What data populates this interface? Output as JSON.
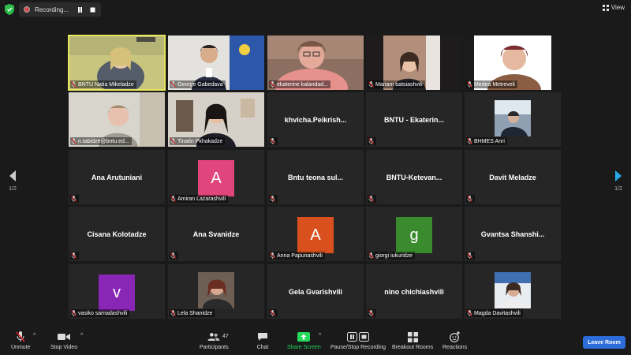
{
  "top": {
    "recording_label": "Recording...",
    "view_label": "View"
  },
  "pager": {
    "left": "1/2",
    "right": "1/2"
  },
  "tiles": [
    {
      "name": "BNTU Natia Mikeladze",
      "type": "video",
      "active": true
    },
    {
      "name": "George Gabedava",
      "type": "video"
    },
    {
      "name": "ekaterine kalandad...",
      "type": "video"
    },
    {
      "name": "Mariam batsiashvili",
      "type": "video"
    },
    {
      "name": "Medea Metreveli",
      "type": "video"
    },
    {
      "name": "n.tabidze@bntu.ed...",
      "type": "video"
    },
    {
      "name": "Tinatin Pkhakadze",
      "type": "video"
    },
    {
      "name": "khvicha.Peikrish...",
      "type": "name"
    },
    {
      "name": "BNTU - Ekaterin...",
      "type": "name"
    },
    {
      "name": "BHMES Anri",
      "type": "photo"
    },
    {
      "name": "Ana Arutuniani",
      "type": "name"
    },
    {
      "name": "Amiran Lazarashvili",
      "type": "avatar",
      "letter": "A",
      "color": "#e0457b"
    },
    {
      "name": "Bntu    teona sul...",
      "type": "name"
    },
    {
      "name": "BNTU-Ketevan...",
      "type": "name"
    },
    {
      "name": "Davit Meladze",
      "type": "name"
    },
    {
      "name": "Cisana Kolotadze",
      "type": "name"
    },
    {
      "name": "Ana Svanidze",
      "type": "name"
    },
    {
      "name": "Anna Papunashvili",
      "type": "avatar",
      "letter": "A",
      "color": "#d9501e"
    },
    {
      "name": "giorgi iukuridze",
      "type": "avatar",
      "letter": "g",
      "color": "#3a8a2e"
    },
    {
      "name": "Gvantsa  Shanshi...",
      "type": "name"
    },
    {
      "name": "vasiko samadashvili",
      "type": "avatar",
      "letter": "v",
      "color": "#8a26b5"
    },
    {
      "name": "Lela Shanidze",
      "type": "photo"
    },
    {
      "name": "Gela Gvarishvili",
      "type": "name"
    },
    {
      "name": "nino chichiashvili",
      "type": "name"
    },
    {
      "name": "Magda Davitashvili",
      "type": "photo"
    }
  ],
  "toolbar": {
    "unmute": "Unmute",
    "stop_video": "Stop Video",
    "participants": "Participants",
    "participants_count": "47",
    "chat": "Chat",
    "share_screen": "Share Screen",
    "pause_recording": "Pause/Stop Recording",
    "breakout_rooms": "Breakout Rooms",
    "reactions": "Reactions",
    "leave": "Leave Room"
  },
  "colors": {
    "background": "#1a1a1a",
    "tile": "#262626",
    "active_border": "#e7e75d",
    "share_green": "#23d959",
    "leave_blue": "#2d6dd9",
    "muted_red": "#e02828"
  }
}
